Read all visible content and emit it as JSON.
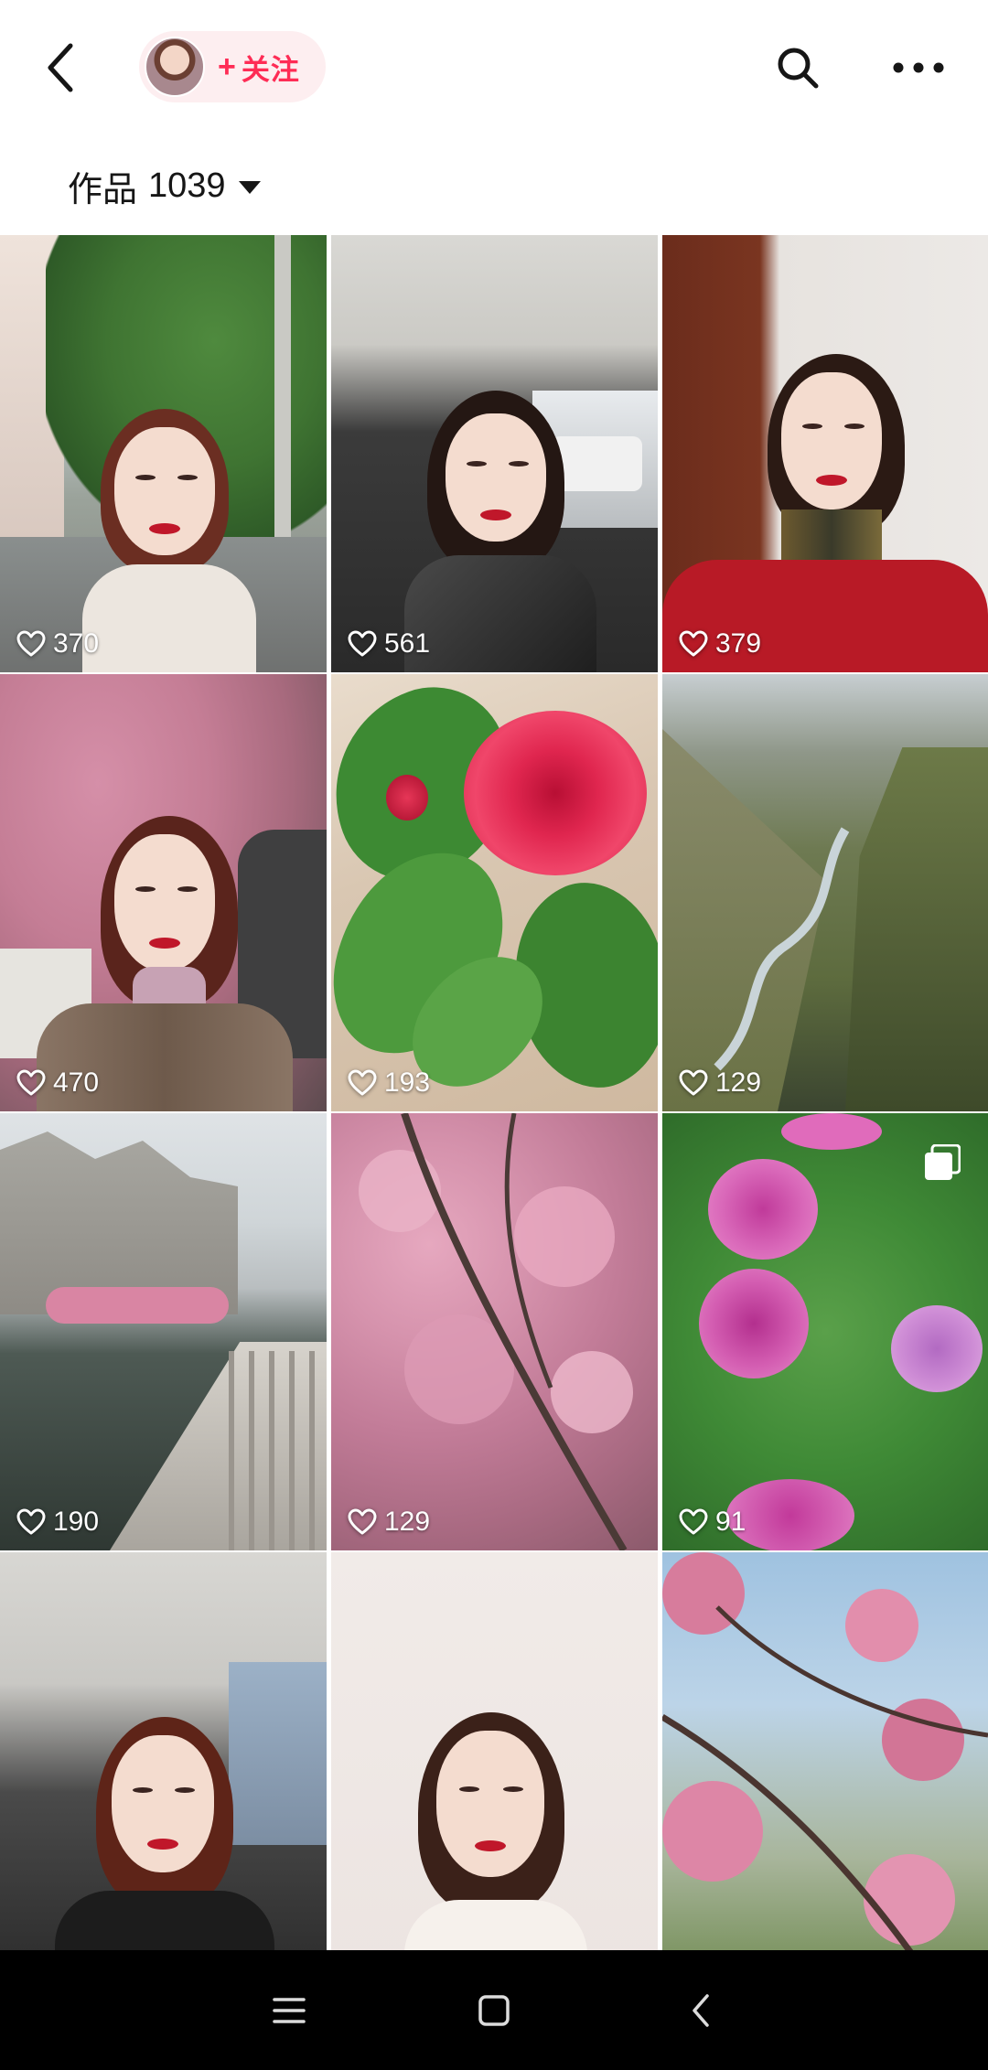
{
  "header": {
    "follow_plus": "+",
    "follow_label": "关注",
    "icons": {
      "back": "back-chevron-icon",
      "search": "search-icon",
      "more": "more-dots-icon"
    },
    "accent_color": "#fe2c55"
  },
  "works": {
    "label": "作品",
    "count": "1039"
  },
  "grid": {
    "tiles": [
      {
        "likes": "370",
        "kind": "selfie-street"
      },
      {
        "likes": "561",
        "kind": "selfie-car"
      },
      {
        "likes": "379",
        "kind": "selfie-indoor-red"
      },
      {
        "likes": "470",
        "kind": "selfie-blossom"
      },
      {
        "likes": "193",
        "kind": "camellia"
      },
      {
        "likes": "129",
        "kind": "valley-river"
      },
      {
        "likes": "190",
        "kind": "canal-bridge"
      },
      {
        "likes": "129",
        "kind": "cherry-blossom"
      },
      {
        "likes": "91",
        "kind": "peonies",
        "multi": true
      },
      {
        "likes": "",
        "kind": "selfie-car-2"
      },
      {
        "likes": "",
        "kind": "selfie-plain"
      },
      {
        "likes": "",
        "kind": "blossom-sky"
      }
    ]
  },
  "system_nav": {
    "icons": [
      "menu-icon",
      "home-square-icon",
      "back-arrow-icon"
    ]
  }
}
